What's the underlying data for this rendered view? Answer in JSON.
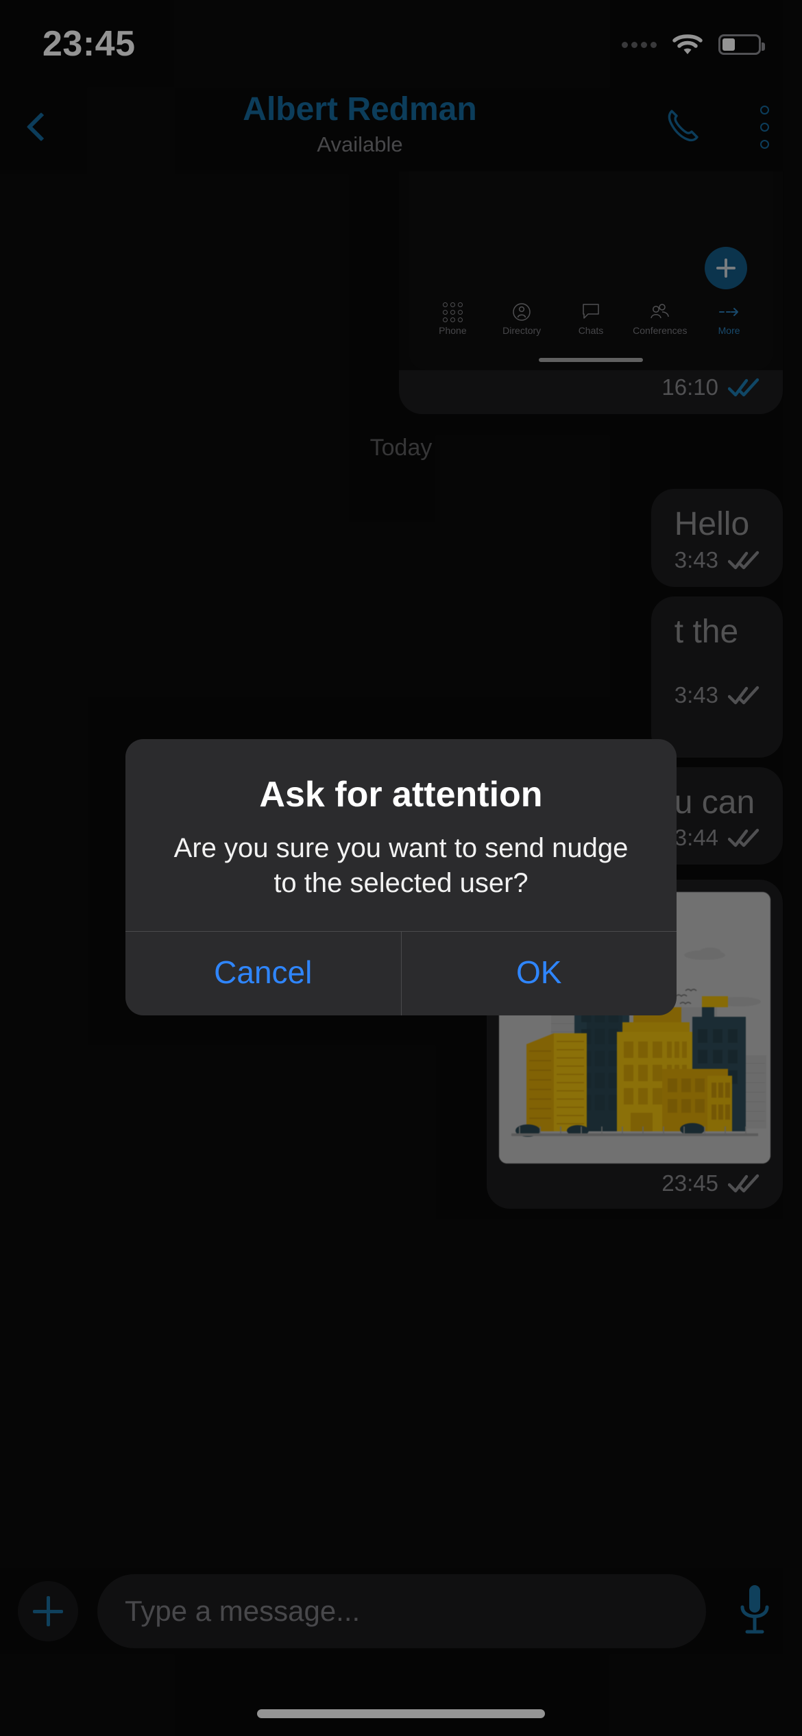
{
  "status_bar": {
    "time": "23:45",
    "signal_icon": "signal-dots-icon",
    "wifi_icon": "wifi-icon",
    "battery_icon": "battery-icon",
    "battery_level_percent": 36
  },
  "nav": {
    "back_icon": "chevron-left-icon",
    "title": "Albert Redman",
    "subtitle": "Available",
    "call_icon": "phone-icon",
    "more_icon": "more-vertical-icon"
  },
  "chat": {
    "day_separator": "Today",
    "messages": [
      {
        "type": "screenshot",
        "time": "16:10",
        "status_icon": "double-check-icon",
        "status_color": "#1d7ab0",
        "nested": {
          "fab_icon": "plus-icon",
          "tabs": [
            {
              "label": "Phone",
              "icon": "keypad-icon",
              "active": false
            },
            {
              "label": "Directory",
              "icon": "contact-icon",
              "active": false
            },
            {
              "label": "Chats",
              "icon": "chat-bubble-icon",
              "active": false
            },
            {
              "label": "Conferences",
              "icon": "group-icon",
              "active": false
            },
            {
              "label": "More",
              "icon": "arrow-right-icon",
              "active": true
            }
          ]
        }
      },
      {
        "type": "text",
        "text": "Hello",
        "time": "3:43",
        "status_icon": "double-check-icon"
      },
      {
        "type": "text",
        "text": "t the",
        "time": "3:43",
        "status_icon": "double-check-icon"
      },
      {
        "type": "text",
        "text": "u can",
        "time": "3:44",
        "status_icon": "double-check-icon"
      },
      {
        "type": "image",
        "alt": "city-skyline-illustration",
        "time": "23:45",
        "status_icon": "double-check-icon"
      }
    ]
  },
  "alert": {
    "title": "Ask for attention",
    "message": "Are you sure you want to send nudge to the selected user?",
    "cancel_label": "Cancel",
    "ok_label": "OK",
    "button_color": "#2f86ff"
  },
  "composer": {
    "attach_icon": "plus-icon",
    "placeholder": "Type a message...",
    "mic_icon": "microphone-icon"
  },
  "colors": {
    "accent_blue": "#15699e",
    "ios_blue": "#2f86ff",
    "bubble": "#1c1c1e",
    "background": "#0a0a0a",
    "illustration_yellow": "#e8b80c",
    "illustration_teal": "#2b4b57"
  }
}
